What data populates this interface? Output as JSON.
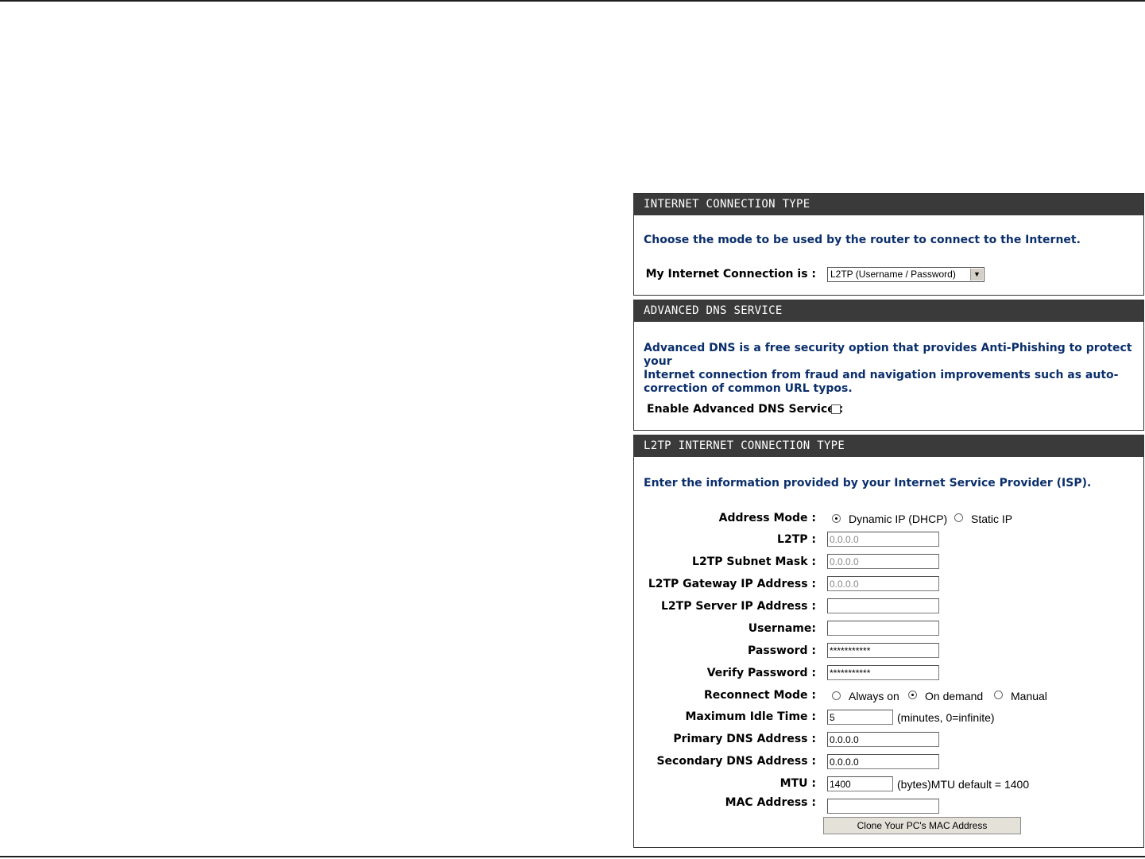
{
  "internet_connection": {
    "header": "INTERNET CONNECTION TYPE",
    "intro": "Choose the mode to be used by the router to connect to the Internet.",
    "label": "My Internet Connection is :",
    "selected": "L2TP (Username / Password)"
  },
  "advanced_dns": {
    "header": "ADVANCED DNS SERVICE",
    "intro_line1": "Advanced DNS is a free security option that provides Anti-Phishing to protect your",
    "intro_line2": "Internet connection from fraud and navigation improvements such as auto-",
    "intro_line3": "correction of common URL typos.",
    "enable_label": "Enable Advanced DNS Service :",
    "enabled": false
  },
  "l2tp": {
    "header": "L2TP INTERNET CONNECTION TYPE",
    "intro": "Enter the information provided by your Internet Service Provider (ISP).",
    "address_mode_label": "Address Mode :",
    "address_mode_options": [
      "Dynamic IP (DHCP)",
      "Static IP"
    ],
    "address_mode_selected": "Dynamic IP (DHCP)",
    "l2tp_label": "L2TP :",
    "l2tp_value": "0.0.0.0",
    "subnet_label": "L2TP Subnet Mask :",
    "subnet_value": "0.0.0.0",
    "gateway_label": "L2TP Gateway IP Address :",
    "gateway_value": "0.0.0.0",
    "server_label": "L2TP Server IP Address :",
    "server_value": "",
    "username_label": "Username:",
    "username_value": "",
    "password_label": "Password :",
    "password_value": "***********",
    "verify_label": "Verify Password :",
    "verify_value": "***********",
    "reconnect_label": "Reconnect Mode :",
    "reconnect_options": [
      "Always on",
      "On demand",
      "Manual"
    ],
    "reconnect_selected": "On demand",
    "idle_label": "Maximum Idle Time :",
    "idle_value": "5",
    "idle_hint": "(minutes, 0=infinite)",
    "primary_dns_label": "Primary DNS Address :",
    "primary_dns_value": "0.0.0.0",
    "secondary_dns_label": "Secondary DNS Address :",
    "secondary_dns_value": "0.0.0.0",
    "mtu_label": "MTU :",
    "mtu_value": "1400",
    "mtu_hint": "(bytes)MTU default = 1400",
    "mac_label": "MAC Address :",
    "mac_value": "",
    "clone_button": "Clone Your PC's MAC Address"
  }
}
